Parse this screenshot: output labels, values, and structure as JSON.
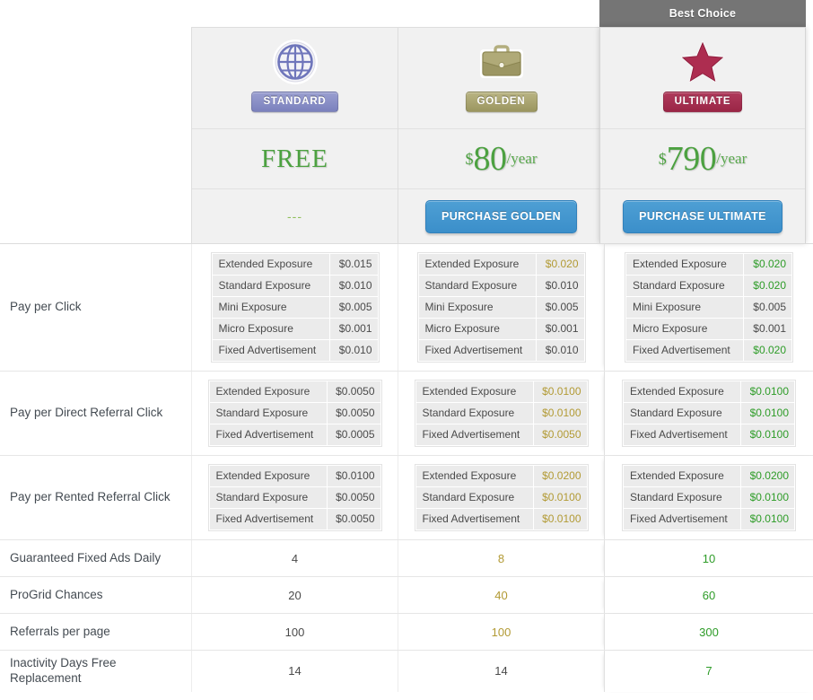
{
  "colors": {
    "best_choice_bg": "#757575",
    "price_green": "#4ca140",
    "buy_blue": "#3b8fca",
    "gold_highlight": "#b29a34",
    "green_highlight": "#2e9c28",
    "standard_tag": "#7b81bd",
    "golden_tag": "#9b9660",
    "ultimate_tag": "#9b2646"
  },
  "plans": [
    {
      "id": "standard",
      "badge": "",
      "badge_visible": false,
      "icon": "globe-icon",
      "tag": "STANDARD",
      "price_currency": "",
      "price_amount": "FREE",
      "price_period": "",
      "is_free": true,
      "buy_label": "---",
      "has_buy_button": false
    },
    {
      "id": "golden",
      "badge": "",
      "badge_visible": false,
      "icon": "briefcase-icon",
      "tag": "GOLDEN",
      "price_currency": "$",
      "price_amount": "80",
      "price_period": "/year",
      "is_free": false,
      "buy_label": "PURCHASE GOLDEN",
      "has_buy_button": true
    },
    {
      "id": "ultimate",
      "badge": "Best Choice",
      "badge_visible": true,
      "icon": "star-icon",
      "tag": "ULTIMATE",
      "price_currency": "$",
      "price_amount": "790",
      "price_period": "/year",
      "is_free": false,
      "buy_label": "PURCHASE ULTIMATE",
      "has_buy_button": true
    }
  ],
  "features": [
    {
      "name": "Pay per Click",
      "type": "subtable",
      "rows": [
        "Extended Exposure",
        "Standard Exposure",
        "Mini Exposure",
        "Micro Exposure",
        "Fixed Advertisement"
      ],
      "standard": {
        "values": [
          "$0.015",
          "$0.010",
          "$0.005",
          "$0.001",
          "$0.010"
        ],
        "highlight": [
          false,
          false,
          false,
          false,
          false
        ]
      },
      "golden": {
        "values": [
          "$0.020",
          "$0.010",
          "$0.005",
          "$0.001",
          "$0.010"
        ],
        "highlight": [
          true,
          false,
          false,
          false,
          false
        ]
      },
      "ultimate": {
        "values": [
          "$0.020",
          "$0.020",
          "$0.005",
          "$0.001",
          "$0.020"
        ],
        "highlight": [
          true,
          true,
          false,
          false,
          true
        ]
      }
    },
    {
      "name": "Pay per Direct Referral Click",
      "type": "subtable",
      "rows": [
        "Extended Exposure",
        "Standard Exposure",
        "Fixed Advertisement"
      ],
      "standard": {
        "values": [
          "$0.0050",
          "$0.0050",
          "$0.0005"
        ],
        "highlight": [
          false,
          false,
          false
        ]
      },
      "golden": {
        "values": [
          "$0.0100",
          "$0.0100",
          "$0.0050"
        ],
        "highlight": [
          true,
          true,
          true
        ]
      },
      "ultimate": {
        "values": [
          "$0.0100",
          "$0.0100",
          "$0.0100"
        ],
        "highlight": [
          true,
          true,
          true
        ]
      }
    },
    {
      "name": "Pay per Rented Referral Click",
      "type": "subtable",
      "rows": [
        "Extended Exposure",
        "Standard Exposure",
        "Fixed Advertisement"
      ],
      "standard": {
        "values": [
          "$0.0100",
          "$0.0050",
          "$0.0050"
        ],
        "highlight": [
          false,
          false,
          false
        ]
      },
      "golden": {
        "values": [
          "$0.0200",
          "$0.0100",
          "$0.0100"
        ],
        "highlight": [
          true,
          true,
          true
        ]
      },
      "ultimate": {
        "values": [
          "$0.0200",
          "$0.0100",
          "$0.0100"
        ],
        "highlight": [
          true,
          true,
          true
        ]
      }
    },
    {
      "name": "Guaranteed Fixed Ads Daily",
      "type": "simple",
      "standard": {
        "value": "4",
        "highlight": false
      },
      "golden": {
        "value": "8",
        "highlight": true
      },
      "ultimate": {
        "value": "10",
        "highlight": true
      }
    },
    {
      "name": "ProGrid Chances",
      "type": "simple",
      "standard": {
        "value": "20",
        "highlight": false
      },
      "golden": {
        "value": "40",
        "highlight": true
      },
      "ultimate": {
        "value": "60",
        "highlight": true
      }
    },
    {
      "name": "Referrals per page",
      "type": "simple",
      "standard": {
        "value": "100",
        "highlight": false
      },
      "golden": {
        "value": "100",
        "highlight": true
      },
      "ultimate": {
        "value": "300",
        "highlight": true
      }
    },
    {
      "name": "Inactivity Days Free Replacement",
      "type": "simple",
      "standard": {
        "value": "14",
        "highlight": false
      },
      "golden": {
        "value": "14",
        "highlight": false
      },
      "ultimate": {
        "value": "7",
        "highlight": true
      }
    }
  ]
}
